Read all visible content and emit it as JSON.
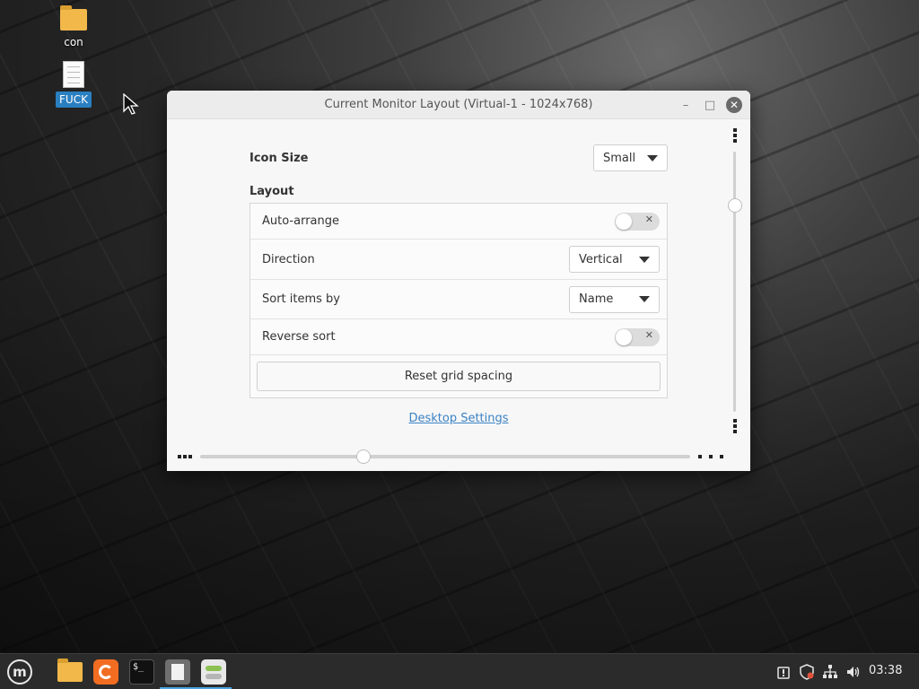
{
  "desktop": {
    "icons": [
      {
        "label": "con",
        "icon": "folder-icon"
      },
      {
        "label": "FUCK",
        "icon": "text-file-icon",
        "selected": true
      }
    ]
  },
  "window": {
    "title": "Current Monitor Layout (Virtual-1 - 1024x768)",
    "minimize_glyph": "–",
    "maximize_glyph": "□",
    "close_glyph": "✕"
  },
  "settings": {
    "icon_size": {
      "label": "Icon Size",
      "value": "Small"
    },
    "layout": {
      "heading": "Layout",
      "auto_arrange": {
        "label": "Auto-arrange",
        "enabled": false
      },
      "direction": {
        "label": "Direction",
        "value": "Vertical"
      },
      "sort_items_by": {
        "label": "Sort items by",
        "value": "Name"
      },
      "reverse_sort": {
        "label": "Reverse sort",
        "enabled": false
      },
      "reset_button": "Reset grid spacing"
    },
    "desktop_settings_link": "Desktop Settings"
  },
  "taskbar": {
    "apps": [
      "menu-icon",
      "files-icon",
      "firefox-icon",
      "terminal-icon",
      "text-editor-icon",
      "settings-icon"
    ],
    "terminal_glyph": "$_",
    "tray": [
      "update-manager-icon",
      "shield-icon",
      "network-icon",
      "volume-icon"
    ],
    "clock": "03:38"
  },
  "colors": {
    "accent": "#2a7fc1",
    "link": "#3b82c4",
    "taskbar": "#2b2b2b",
    "active_indicator": "#4aa3df"
  }
}
